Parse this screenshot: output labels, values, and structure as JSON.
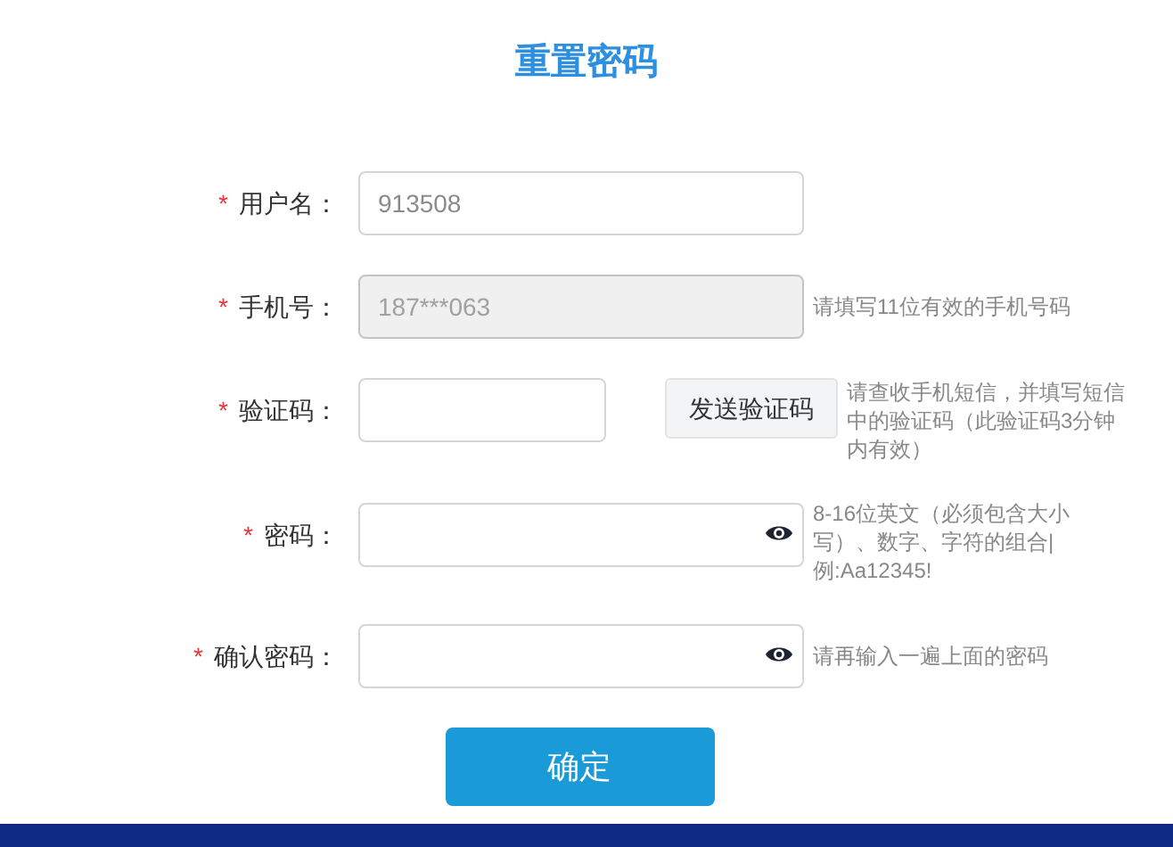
{
  "title": "重置密码",
  "fields": [
    {
      "kind": "text",
      "label": "用户名：",
      "mark": "*",
      "value": "913508",
      "disabled": false
    },
    {
      "kind": "text",
      "label": "手机号：",
      "mark": "*",
      "value": "187***063",
      "disabled": true,
      "hint": "请填写11位有效的手机号码"
    },
    {
      "kind": "code",
      "label": "验证码：",
      "mark": "*",
      "disabled": false,
      "button": "发送验证码",
      "hint": "请查收手机短信，并填写短信中的验证码（此验证码3分钟内有效）"
    },
    {
      "kind": "password",
      "label": "密码：",
      "mark": "*",
      "disabled": false,
      "hint": "8-16位英文（必须包含大小写）、数字、字符的组合|例:Aa12345!"
    },
    {
      "kind": "password",
      "label": "确认密码：",
      "mark": "*",
      "disabled": false,
      "hint": "请再输入一遍上面的密码"
    }
  ],
  "submit": "确定"
}
